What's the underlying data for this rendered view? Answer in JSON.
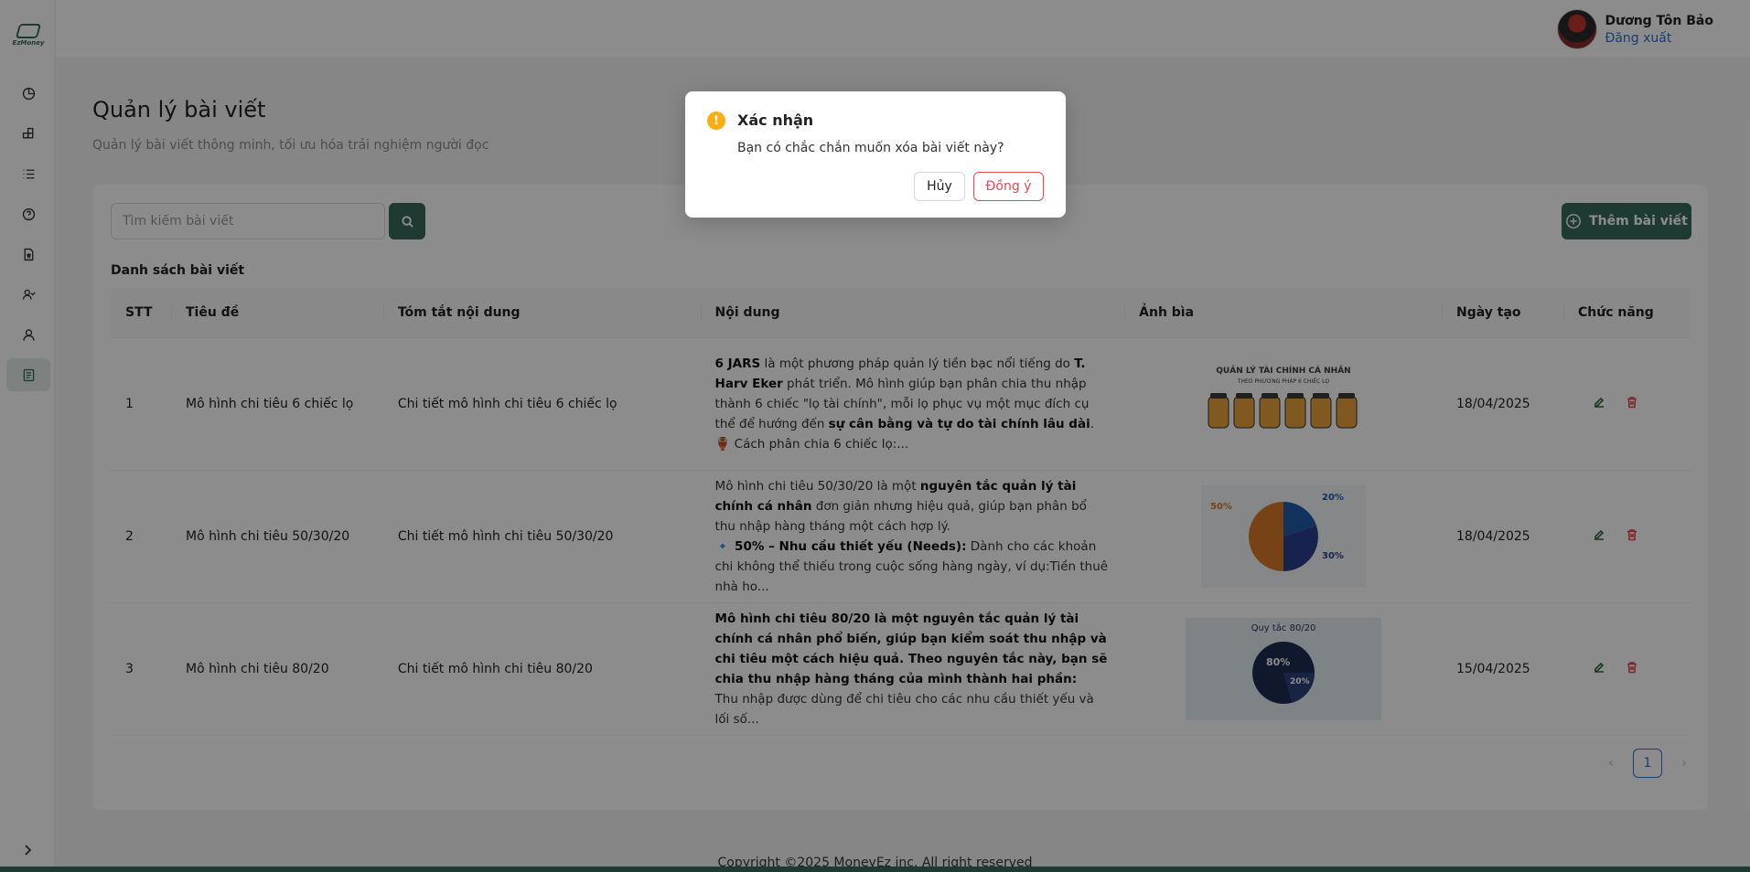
{
  "app": {
    "logo_text": "EzMoney"
  },
  "header": {
    "user_name": "Dương Tôn Bảo",
    "logout_label": "Đăng xuất"
  },
  "page": {
    "title": "Quản lý bài viết",
    "subtitle": "Quản lý bài viết thông minh, tối ưu hóa trải nghiệm người đọc"
  },
  "toolbar": {
    "search_placeholder": "Tìm kiếm bài viết",
    "add_label": "Thêm bài viết"
  },
  "list": {
    "title": "Danh sách bài viết",
    "columns": [
      "STT",
      "Tiêu đề",
      "Tóm tắt nội dung",
      "Nội dung",
      "Ảnh bìa",
      "Ngày tạo",
      "Chức năng"
    ],
    "rows": [
      {
        "stt": "1",
        "title": "Mô hình chi tiêu 6 chiếc lọ",
        "summary": "Chi tiết mô hình chi tiêu 6 chiếc lọ",
        "content": {
          "b1": "6 JARS",
          "t1": " là một phương pháp quản lý tiền bạc nổi tiếng do ",
          "b2": "T. Harv Eker",
          "t2": " phát triển. Mô hình giúp bạn phân chia thu nhập thành 6 chiếc \"lọ tài chính\", mỗi lọ phục vụ một mục đích cụ thể để hướng đến ",
          "b3": "sự cân bằng và tự do tài chính lâu dài",
          "t3": ".",
          "line": "🏺 Cách phân chia 6 chiếc lọ:..."
        },
        "thumb_title": "QUẢN LÝ TÀI CHÍNH CÁ NHÂN",
        "thumb_sub": "THEO PHƯƠNG PHÁP 6 CHIẾC LỌ",
        "date": "18/04/2025"
      },
      {
        "stt": "2",
        "title": "Mô hình chi tiêu 50/30/20",
        "summary": "Chi tiết mô hình chi tiêu 50/30/20",
        "content": {
          "t1": "Mô hình chi tiêu 50/30/20 là một ",
          "b1": "nguyên tắc quản lý tài chính cá nhân",
          "t2": " đơn giản nhưng hiệu quả, giúp bạn phân bổ thu nhập hàng tháng một cách hợp lý.",
          "b2": "🔹 50% – Nhu cầu thiết yếu (Needs):",
          "t3": " Dành cho các khoản chi không thể thiếu trong cuộc sống hàng ngày, ví dụ:Tiền thuê nhà ho..."
        },
        "thumb_labels": [
          "50%",
          "20%",
          "30%"
        ],
        "date": "18/04/2025"
      },
      {
        "stt": "3",
        "title": "Mô hình chi tiêu 80/20",
        "summary": "Chi tiết mô hình chi tiêu 80/20",
        "content": {
          "b1": "Mô hình chi tiêu 80/20 là một nguyên tắc quản lý tài chính cá nhân phổ biến, giúp bạn kiểm soát thu nhập và chi tiêu một cách hiệu quả. Theo nguyên tắc này, bạn sẽ chia thu nhập hàng tháng của mình thành hai phần:",
          "t1": "Thu nhập được dùng để chi tiêu cho các nhu cầu thiết yếu và lối số..."
        },
        "thumb_title": "Quy tắc 80/20",
        "thumb_labels": [
          "80%",
          "20%"
        ],
        "date": "15/04/2025"
      }
    ]
  },
  "pagination": {
    "current": "1",
    "prev": "‹",
    "next": "›"
  },
  "footer": {
    "text": "Copyright ©2025 MoneyEz inc. All right reserved"
  },
  "modal": {
    "icon": "!",
    "title": "Xác nhận",
    "message": "Bạn có chắc chắn muốn xóa bài viết này?",
    "cancel_label": "Hủy",
    "ok_label": "Đồng ý"
  },
  "colors": {
    "primary": "#3a6b5c",
    "danger": "#e5484d",
    "warning": "#faad14",
    "link": "#2f6fd6"
  }
}
